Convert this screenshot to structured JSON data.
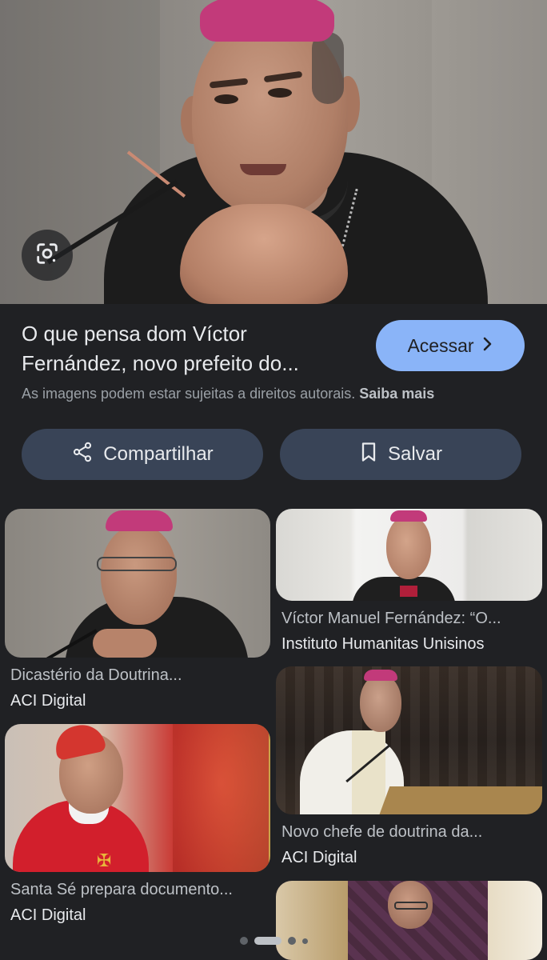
{
  "hero": {
    "alt_subject": "main-image"
  },
  "lens_button": {
    "icon": "camera-lens-icon"
  },
  "result": {
    "title": "O que pensa dom Víctor Fernández, novo prefeito do...",
    "access_label": "Acessar",
    "copyright_text": "As imagens podem estar sujeitas a direitos autorais.",
    "learn_more_label": "Saiba mais"
  },
  "actions": {
    "share_label": "Compartilhar",
    "save_label": "Salvar"
  },
  "related": [
    {
      "caption": "Dicastério da Doutrina...",
      "source": "ACI Digital"
    },
    {
      "caption": "Víctor Manuel Fernández: “O...",
      "source": "Instituto Humanitas Unisinos"
    },
    {
      "caption": "Santa Sé prepara documento...",
      "source": "ACI Digital"
    },
    {
      "caption": "Novo chefe de doutrina da...",
      "source": "ACI Digital"
    },
    {
      "caption": "",
      "source": ""
    }
  ],
  "colors": {
    "background": "#202124",
    "accent_button": "#8ab4f8",
    "action_button": "#394457",
    "zucchetto": "#c23a7a",
    "cardinal_red": "#d21f2c"
  },
  "pagination": {
    "total": 4,
    "active": 1
  }
}
